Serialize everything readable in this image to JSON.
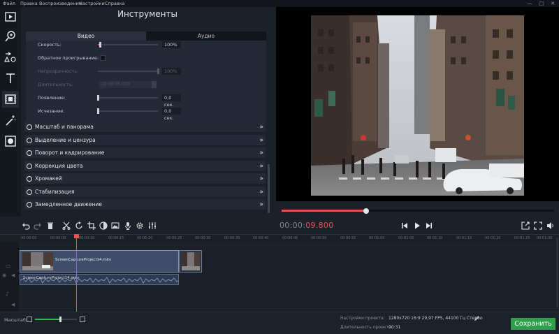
{
  "menu": {
    "items": [
      "Файл",
      "Правка",
      "Воспроизведение",
      "Настройки",
      "Справка"
    ],
    "window_controls": [
      "—",
      "□",
      "✕"
    ]
  },
  "toolstrip": {
    "items": [
      "import-video-icon",
      "magnify-icon",
      "shapes-icon",
      "text-icon",
      "filmstrip-icon",
      "magic-wand-icon",
      "transitions-icon"
    ],
    "active_index": 4
  },
  "tools_panel": {
    "title": "Инструменты",
    "tabs": [
      "Видео",
      "Аудио"
    ],
    "active_tab": 0,
    "properties": {
      "speed": {
        "label": "Скорость:",
        "value": "100%",
        "level": 0.04
      },
      "reverse": {
        "label": "Обратное проигрывание:"
      },
      "opacity": {
        "label": "Непрозрачность:",
        "value": "100%",
        "level": 1.0
      },
      "duration": {
        "label": "Длительность:",
        "value": "00:00:05.000"
      },
      "fade_in": {
        "label": "Появление:",
        "value": "0,0 сек.",
        "level": 0.0
      },
      "fade_out": {
        "label": "Исчезание:",
        "value": "0,0 сек.",
        "level": 0.0
      }
    },
    "sections": [
      "Масштаб и панорама",
      "Выделение и цензура",
      "Поворот и кадрирование",
      "Коррекция цвета",
      "Хромакей",
      "Стабилизация",
      "Замедленное движение"
    ]
  },
  "player": {
    "progress": 0.31,
    "timecode_prefix": "00:00:",
    "timecode_active": "09.800"
  },
  "toolbar": {
    "buttons": [
      "undo-icon",
      "redo-icon",
      "delete-icon",
      "cut-icon",
      "rotate-icon",
      "crop-icon",
      "color-adjust-icon",
      "image-icon",
      "microphone-icon",
      "settings-icon",
      "equalizer-icon"
    ],
    "playback": [
      "previous-frame-icon",
      "play-icon",
      "next-frame-icon"
    ],
    "right": [
      "export-icon",
      "fullscreen-icon",
      "volume-icon"
    ]
  },
  "timeline": {
    "ticks": [
      "00:00:00",
      "00:00:05",
      "00:00:10",
      "00:00:15",
      "00:00:20",
      "00:00:25",
      "00:00:30",
      "00:00:35",
      "00:00:40",
      "00:00:45",
      "00:00:50",
      "00:00:55",
      "00:01:00",
      "00:01:05",
      "00:01:10",
      "00:01:15",
      "00:01:20",
      "00:01:25",
      "00:01:30",
      "00:01:35"
    ],
    "clip_name": "ScreenCaptureProject14.mkv",
    "audio_name": "ScreenCaptureProject14.mkv"
  },
  "bottom": {
    "scale_label": "Масштаб:",
    "zoom_level": 0.6,
    "project_settings_label": "Настройки проекта:",
    "project_settings_value": "1280x720 16:9 29,97 FPS, 44100 Гц Стерео",
    "project_duration_label": "Длительность проекта:",
    "project_duration_value": "00:31",
    "save_label": "Сохранить"
  },
  "colors": {
    "accent": "#e8534d",
    "save": "#2ea04b",
    "zoom": "#3bb15a"
  }
}
